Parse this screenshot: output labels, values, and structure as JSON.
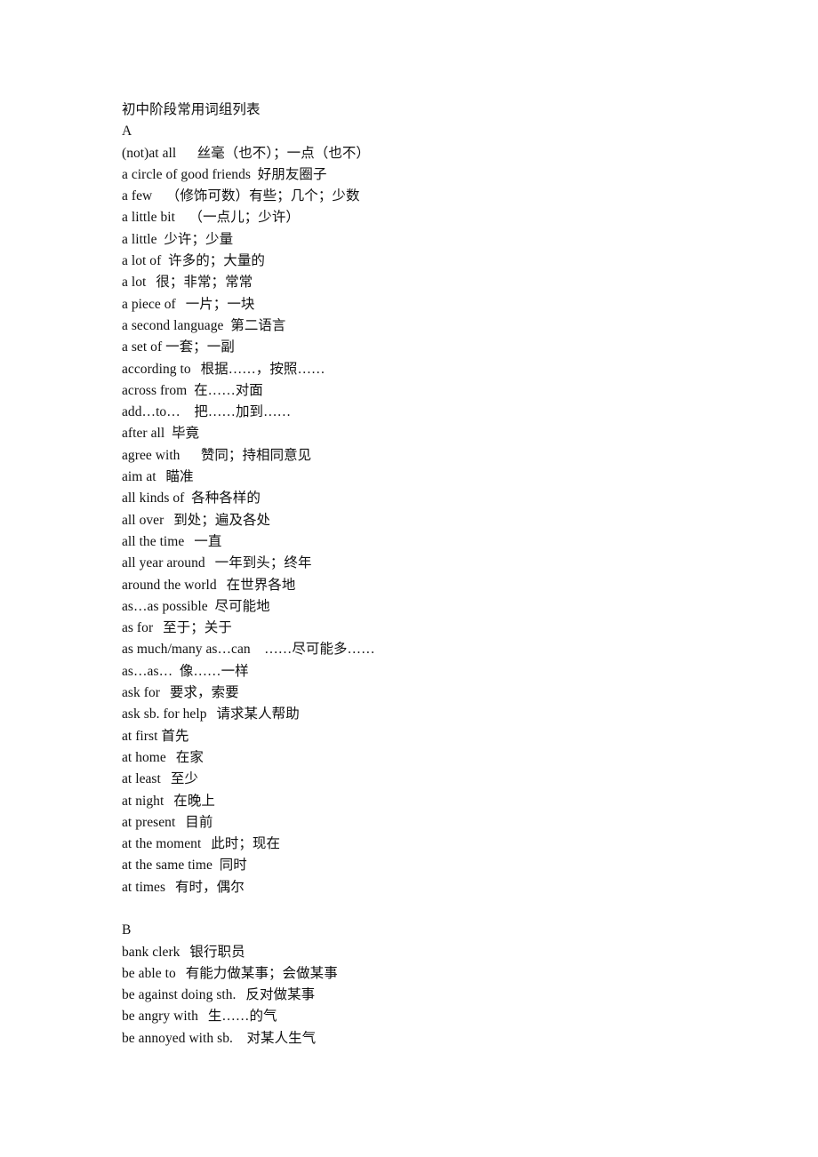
{
  "document": {
    "title": "初中阶段常用词组列表",
    "background_color": "#ffffff",
    "text_color": "#111111",
    "lines": [
      {
        "kind": "title",
        "text": "初中阶段常用词组列表"
      },
      {
        "kind": "section",
        "text": "A"
      },
      {
        "kind": "entry",
        "text": "(not)at all  丝毫（也不）；一点（也不）"
      },
      {
        "kind": "entry",
        "text": "a circle of good friends 好朋友圈子"
      },
      {
        "kind": "entry",
        "text": "a few （修饰可数）有些；几个；少数"
      },
      {
        "kind": "entry",
        "text": "a little bit （一点儿；少许）"
      },
      {
        "kind": "entry",
        "text": "a little 少许；少量"
      },
      {
        "kind": "entry",
        "text": "a lot of 许多的；大量的"
      },
      {
        "kind": "entry",
        "text": "a lot  很；非常；常常"
      },
      {
        "kind": "entry",
        "text": "a piece of  一片；一块"
      },
      {
        "kind": "entry",
        "text": "a second language 第二语言"
      },
      {
        "kind": "entry",
        "text": "a set of 一套；一副"
      },
      {
        "kind": "entry",
        "text": "according to  根据……，按照……"
      },
      {
        "kind": "entry",
        "text": "across from 在……对面"
      },
      {
        "kind": "entry",
        "text": "add…to… 把……加到……"
      },
      {
        "kind": "entry",
        "text": "after all 毕竟"
      },
      {
        "kind": "entry",
        "text": "agree with  赞同；持相同意见"
      },
      {
        "kind": "entry",
        "text": "aim at  瞄准"
      },
      {
        "kind": "entry",
        "text": "all kinds of 各种各样的"
      },
      {
        "kind": "entry",
        "text": "all over  到处；遍及各处"
      },
      {
        "kind": "entry",
        "text": "all the time  一直"
      },
      {
        "kind": "entry",
        "text": "all year around  一年到头；终年"
      },
      {
        "kind": "entry",
        "text": "around the world  在世界各地"
      },
      {
        "kind": "entry",
        "text": "as…as possible 尽可能地"
      },
      {
        "kind": "entry",
        "text": "as for  至于；关于"
      },
      {
        "kind": "entry",
        "text": "as much/many as…can ……尽可能多……"
      },
      {
        "kind": "entry",
        "text": "as…as… 像……一样"
      },
      {
        "kind": "entry",
        "text": "ask for  要求，索要"
      },
      {
        "kind": "entry",
        "text": "ask sb. for help  请求某人帮助"
      },
      {
        "kind": "entry",
        "text": "at first 首先"
      },
      {
        "kind": "entry",
        "text": "at home  在家"
      },
      {
        "kind": "entry",
        "text": "at least  至少"
      },
      {
        "kind": "entry",
        "text": "at night  在晚上"
      },
      {
        "kind": "entry",
        "text": "at present  目前"
      },
      {
        "kind": "entry",
        "text": "at the moment  此时；现在"
      },
      {
        "kind": "entry",
        "text": "at the same time 同时"
      },
      {
        "kind": "entry",
        "text": "at times  有时，偶尔"
      },
      {
        "kind": "blank",
        "text": ""
      },
      {
        "kind": "section",
        "text": "B"
      },
      {
        "kind": "entry",
        "text": "bank clerk  银行职员"
      },
      {
        "kind": "entry",
        "text": "be able to  有能力做某事；会做某事"
      },
      {
        "kind": "entry",
        "text": "be against doing sth.  反对做某事"
      },
      {
        "kind": "entry",
        "text": "be angry with  生……的气"
      },
      {
        "kind": "entry",
        "text": "be annoyed with sb. 对某人生气"
      }
    ]
  }
}
